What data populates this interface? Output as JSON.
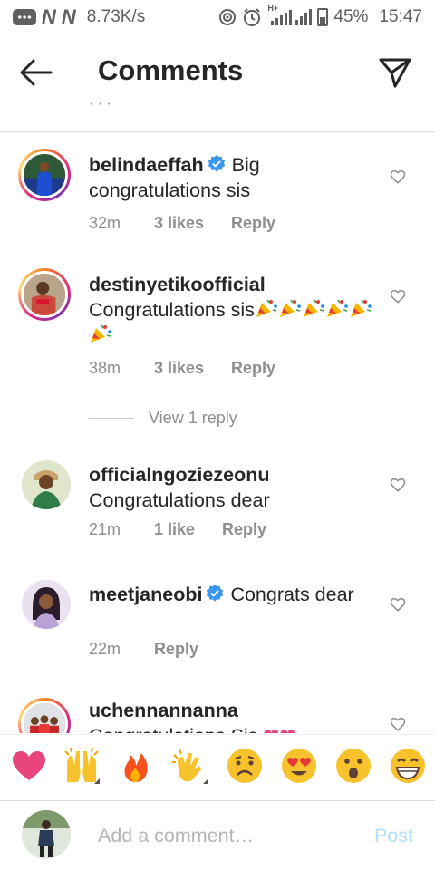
{
  "status_bar": {
    "speed": "8.73K/s",
    "network_type": "H+",
    "battery": "45%",
    "time": "15:47"
  },
  "header": {
    "title": "Comments"
  },
  "comments": [
    {
      "username": "belindaeffah",
      "verified": true,
      "text": "Big congratulations sis",
      "time": "32m",
      "likes": "3 likes",
      "reply": "Reply"
    },
    {
      "username": "destinyetikoofficial",
      "verified": false,
      "text": "Congratulations sis",
      "emojis": [
        "party-popper",
        "party-popper",
        "party-popper",
        "party-popper",
        "party-popper",
        "party-popper"
      ],
      "time": "38m",
      "likes": "3 likes",
      "reply": "Reply",
      "view_replies": "View 1 reply"
    },
    {
      "username": "officialngoziezeonu",
      "verified": false,
      "text": "Congratulations dear",
      "time": "21m",
      "likes": "1 like",
      "reply": "Reply"
    },
    {
      "username": "meetjaneobi",
      "verified": true,
      "text": "Congrats dear",
      "time": "22m",
      "reply": "Reply"
    },
    {
      "username": "uchennannanna",
      "verified": false,
      "text": "Congratulations Sis",
      "emojis": [
        "heart",
        "heart"
      ]
    }
  ],
  "emoji_bar": [
    "red-heart",
    "raising-hands",
    "fire",
    "clapping-hands",
    "sad-face",
    "heart-eyes-face",
    "surprised-face",
    "grinning-face"
  ],
  "composer": {
    "placeholder": "Add a comment…",
    "post_label": "Post"
  },
  "colors": {
    "verified_blue": "#3897f0",
    "post_disabled": "#b2dffc",
    "meta_grey": "#8e8e8e"
  }
}
